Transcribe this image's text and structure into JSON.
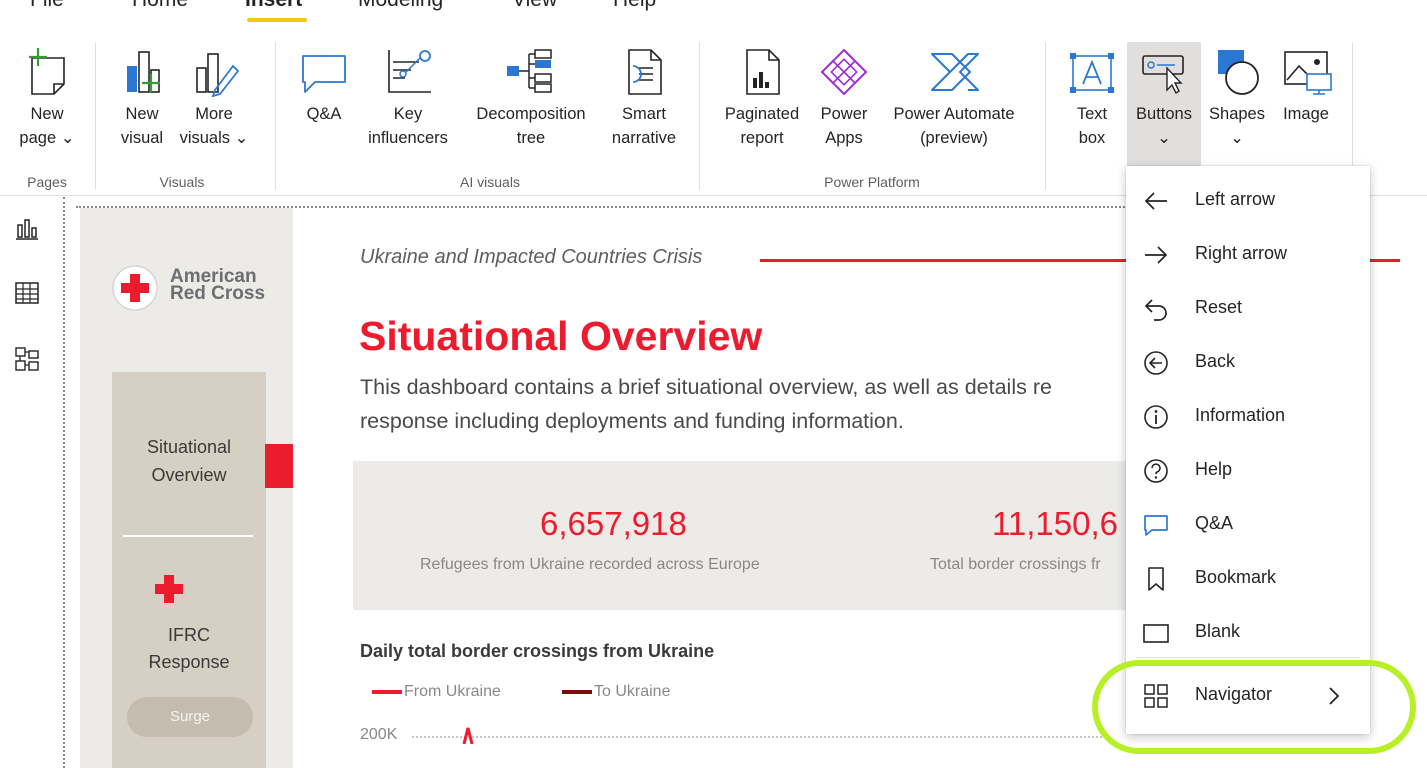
{
  "menu": {
    "tabs": [
      {
        "label": "File",
        "active": false
      },
      {
        "label": "Home",
        "active": false
      },
      {
        "label": "Insert",
        "active": true
      },
      {
        "label": "Modeling",
        "active": false
      },
      {
        "label": "View",
        "active": false
      },
      {
        "label": "Help",
        "active": false
      }
    ]
  },
  "ribbon": {
    "pages": {
      "new_page_line1": "New",
      "new_page_line2": "page",
      "group": "Pages"
    },
    "visuals": {
      "new_visual_line1": "New",
      "new_visual_line2": "visual",
      "more_visuals_line1": "More",
      "more_visuals_line2": "visuals",
      "group": "Visuals"
    },
    "ai_visuals": {
      "qa": "Q&A",
      "key_influencers_line1": "Key",
      "key_influencers_line2": "influencers",
      "decomposition_line1": "Decomposition",
      "decomposition_line2": "tree",
      "smart_line1": "Smart",
      "smart_line2": "narrative",
      "group": "AI visuals"
    },
    "power_platform": {
      "paginated_line1": "Paginated",
      "paginated_line2": "report",
      "power_apps_line1": "Power",
      "power_apps_line2": "Apps",
      "power_automate_line1": "Power Automate",
      "power_automate_line2": "(preview)",
      "group": "Power Platform"
    },
    "elements": {
      "text_box_line1": "Text",
      "text_box_line2": "box",
      "buttons": "Buttons",
      "shapes": "Shapes",
      "image": "Image"
    }
  },
  "report": {
    "org_line1": "American",
    "org_line2": "Red Cross",
    "nav": {
      "situational_line1": "Situational",
      "situational_line2": "Overview",
      "ifrc_line1": "IFRC",
      "ifrc_line2": "Response",
      "surge": "Surge"
    },
    "kicker": "Ukraine and Impacted Countries Crisis",
    "title": "Situational Overview",
    "description_line1": "This dashboard contains a brief situational overview, as well as details re",
    "description_line2": "response including deployments and funding information.",
    "kpis": [
      {
        "value": "6,657,918",
        "label": "Refugees from Ukraine recorded across Europe"
      },
      {
        "value": "11,150,6",
        "label": "Total border crossings fr"
      }
    ],
    "chart": {
      "title": "Daily total border crossings from Ukraine",
      "legend": [
        {
          "label": "From Ukraine",
          "color": "#ed1b2e"
        },
        {
          "label": "To Ukraine",
          "color": "#7a0e0e"
        }
      ],
      "y_tick": "200K"
    }
  },
  "buttons_dropdown": {
    "items": [
      {
        "label": "Left arrow",
        "icon": "left-arrow-icon"
      },
      {
        "label": "Right arrow",
        "icon": "right-arrow-icon"
      },
      {
        "label": "Reset",
        "icon": "reset-icon"
      },
      {
        "label": "Back",
        "icon": "back-icon"
      },
      {
        "label": "Information",
        "icon": "information-icon"
      },
      {
        "label": "Help",
        "icon": "help-icon"
      },
      {
        "label": "Q&A",
        "icon": "qa-icon"
      },
      {
        "label": "Bookmark",
        "icon": "bookmark-icon"
      },
      {
        "label": "Blank",
        "icon": "blank-icon"
      },
      {
        "label": "Navigator",
        "icon": "navigator-icon",
        "has_submenu": true
      }
    ]
  },
  "colors": {
    "accent_red": "#ed1b2e",
    "tab_underline": "#f2c811",
    "highlight": "#b7f025",
    "powerbi_blue": "#2b78d4",
    "power_apps_purple": "#a02cd4"
  }
}
